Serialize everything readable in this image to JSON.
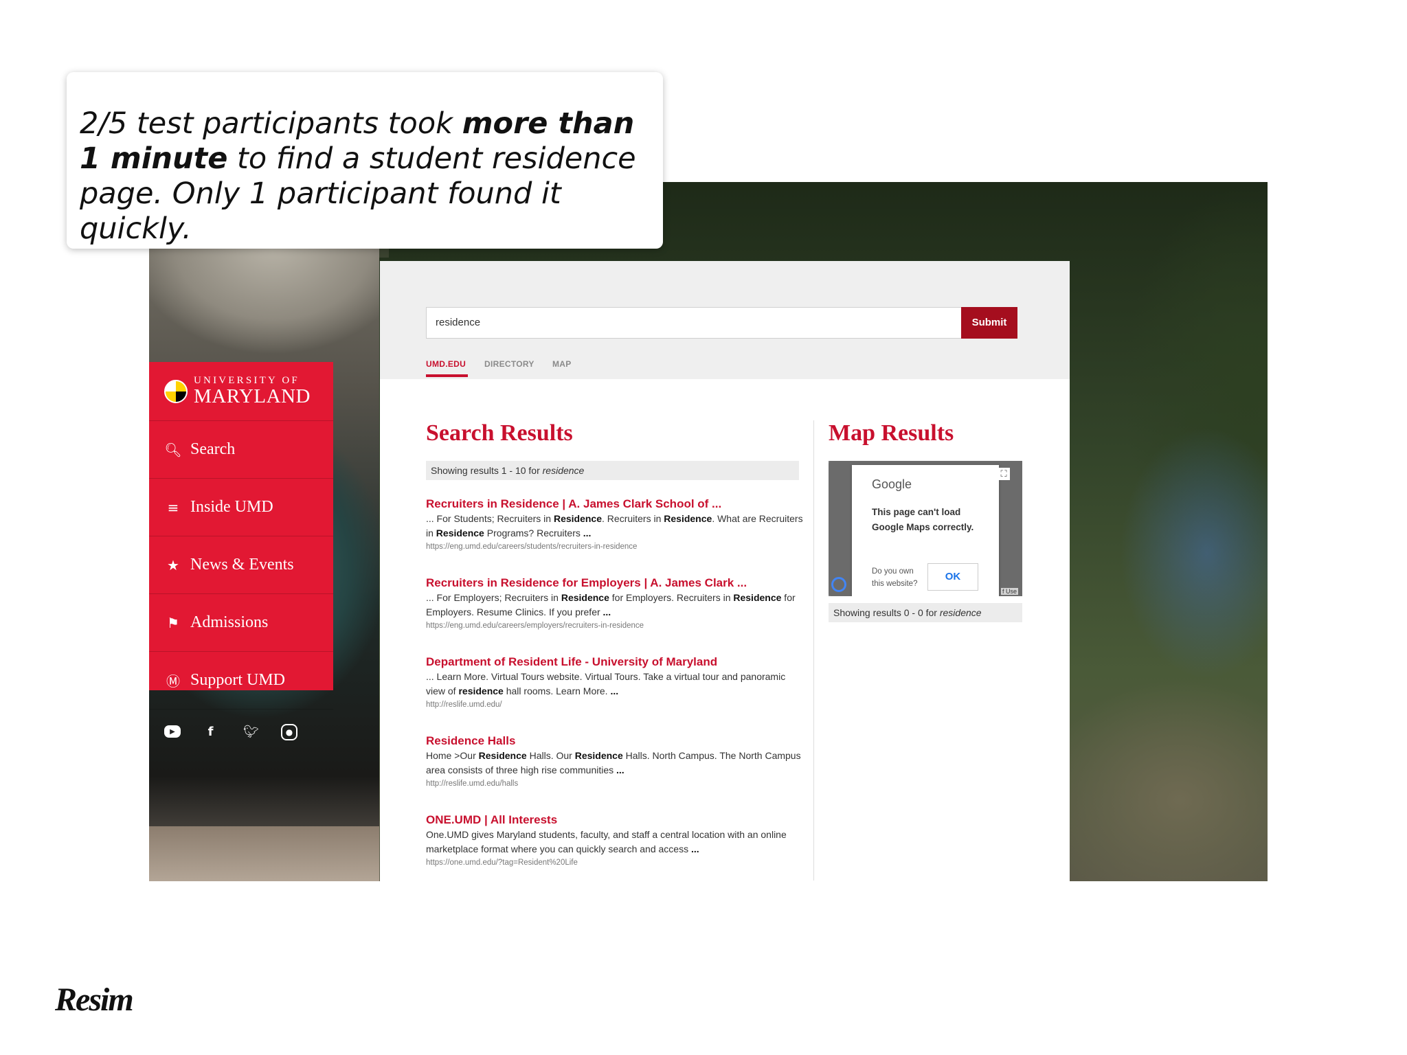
{
  "callout": {
    "part1": "2/5 test participants took ",
    "bold": "more than 1 minute",
    "part2": " to find a student residence page. Only 1 participant found it quickly."
  },
  "brand": {
    "text": "Resim"
  },
  "umd": {
    "logo": {
      "line1": "UNIVERSITY OF",
      "line2": "MARYLAND"
    },
    "nav": [
      {
        "label": "Search",
        "icon": "search-icon"
      },
      {
        "label": "Inside UMD",
        "icon": "menu-icon"
      },
      {
        "label": "News & Events",
        "icon": "star-icon"
      },
      {
        "label": "Admissions",
        "icon": "flag-icon"
      },
      {
        "label": "Support UMD",
        "icon": "umd-m-icon"
      }
    ],
    "social": [
      "youtube-icon",
      "facebook-icon",
      "twitter-icon",
      "instagram-icon"
    ],
    "colors": {
      "red": "#e21833",
      "dark_red": "#a50e1e",
      "link_red": "#c8102e"
    }
  },
  "search": {
    "query": "residence",
    "submit_label": "Submit",
    "tabs": [
      {
        "label": "UMD.EDU",
        "active": true
      },
      {
        "label": "DIRECTORY",
        "active": false
      },
      {
        "label": "MAP",
        "active": false
      }
    ],
    "results_title": "Search Results",
    "results_count": {
      "prefix": "Showing results 1 - 10 for ",
      "term": "residence"
    },
    "results": [
      {
        "title": "Recruiters in Residence | A. James Clark School of ...",
        "snippet": [
          {
            "t": "... For Students; Recruiters in "
          },
          {
            "b": "Residence"
          },
          {
            "t": ". Recruiters in "
          },
          {
            "b": "Residence"
          },
          {
            "t": ". What are Recruiters in "
          },
          {
            "b": "Residence"
          },
          {
            "t": " Programs? Recruiters "
          },
          {
            "b": "..."
          }
        ],
        "url": "https://eng.umd.edu/careers/students/recruiters-in-residence"
      },
      {
        "title": "Recruiters in Residence for Employers | A. James Clark ...",
        "snippet": [
          {
            "t": "... For Employers; Recruiters in "
          },
          {
            "b": "Residence"
          },
          {
            "t": " for Employers. Recruiters in "
          },
          {
            "b": "Residence"
          },
          {
            "t": " for Employers. Resume Clinics. If you prefer "
          },
          {
            "b": "..."
          }
        ],
        "url": "https://eng.umd.edu/careers/employers/recruiters-in-residence"
      },
      {
        "title": "Department of Resident Life - University of Maryland",
        "snippet": [
          {
            "t": "... Learn More. Virtual Tours website. Virtual Tours. Take a virtual tour and panoramic view of "
          },
          {
            "b": "residence"
          },
          {
            "t": " hall rooms. Learn More. "
          },
          {
            "b": "..."
          }
        ],
        "url": "http://reslife.umd.edu/"
      },
      {
        "title": "Residence Halls",
        "snippet": [
          {
            "t": "Home >Our "
          },
          {
            "b": "Residence"
          },
          {
            "t": " Halls. Our "
          },
          {
            "b": "Residence"
          },
          {
            "t": " Halls. North Campus. The North Campus area consists of three high rise communities "
          },
          {
            "b": "..."
          }
        ],
        "url": "http://reslife.umd.edu/halls"
      },
      {
        "title": "ONE.UMD | All Interests",
        "snippet": [
          {
            "t": "One.UMD gives Maryland students, faculty, and staff a central location with an online marketplace format where you can quickly search and access "
          },
          {
            "b": "..."
          }
        ],
        "url": "https://one.umd.edu/?tag=Resident%20Life"
      }
    ],
    "map_title": "Map Results",
    "map_count": {
      "prefix": "Showing results 0 - 0 for ",
      "term": "residence"
    },
    "map_error": {
      "brand": "Google",
      "message": "This page can't load Google Maps correctly.",
      "question": "Do you own this website?",
      "ok_label": "OK",
      "terms": "f Use"
    }
  }
}
